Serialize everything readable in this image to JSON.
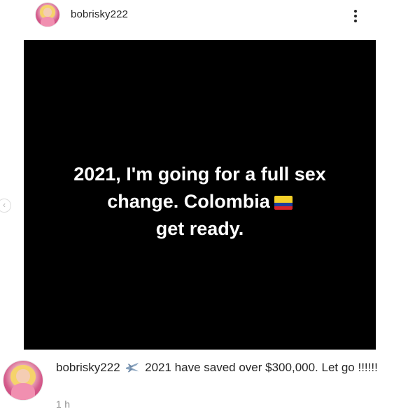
{
  "header": {
    "username": "bobrisky222",
    "more_icon": "more-options-icon"
  },
  "post": {
    "text_before_flag": "2021, I'm going for a full sex change. Colombia",
    "text_after_flag": "get ready.",
    "flag_icon": "colombia-flag-icon",
    "background_color": "#000000",
    "text_color": "#ffffff"
  },
  "carousel": {
    "prev_icon": "chevron-left-icon",
    "prev_glyph": "‹"
  },
  "caption": {
    "username": "bobrisky222",
    "emoji_icon": "airplane-icon",
    "text": "2021 have saved over $300,000. Let go !!!!!!"
  },
  "timestamp": "1 h"
}
